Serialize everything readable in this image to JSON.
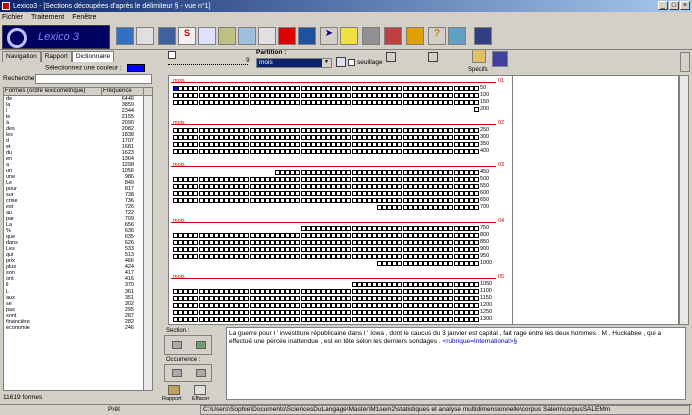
{
  "window": {
    "title": "Lexico3 - [Sections  découpées d'après le délimiteur  §  - vue n°1]"
  },
  "menu": [
    "Fichier",
    "Traitement",
    "Fenêtre"
  ],
  "app_logo": "Lexico 3",
  "left_panel": {
    "tabs": [
      "Navigation",
      "Rapport",
      "Dictionnaire"
    ],
    "active_tab": "Dictionnaire",
    "select_color_label": "Sélectionnez une couleur :",
    "select_color_value": "#0000ff",
    "search_label": "Recherche :",
    "search_value": "",
    "table": {
      "headers": [
        "Formes (ordre lexicométrique)",
        "Fréquence"
      ],
      "rows": [
        [
          "de",
          "6446"
        ],
        [
          "la",
          "3859"
        ],
        [
          "l",
          "2344"
        ],
        [
          "le",
          "2155"
        ],
        [
          "à",
          "2090"
        ],
        [
          "des",
          "2082"
        ],
        [
          "les",
          "1838"
        ],
        [
          "d",
          "1707"
        ],
        [
          "et",
          "1681"
        ],
        [
          "du",
          "1623"
        ],
        [
          "en",
          "1364"
        ],
        [
          "a",
          "1298"
        ],
        [
          "un",
          "1056"
        ],
        [
          "une",
          "986"
        ],
        [
          "Le",
          "849"
        ],
        [
          "pour",
          "817"
        ],
        [
          "sur",
          "738"
        ],
        [
          "crise",
          "736"
        ],
        [
          "est",
          "726"
        ],
        [
          "au",
          "722"
        ],
        [
          "par",
          "709"
        ],
        [
          "La",
          "656"
        ],
        [
          "%",
          "636"
        ],
        [
          "que",
          "635"
        ],
        [
          "dans",
          "626"
        ],
        [
          "Les",
          "533"
        ],
        [
          "qui",
          "513"
        ],
        [
          "prix",
          "466"
        ],
        [
          "plus",
          "424"
        ],
        [
          "son",
          "417"
        ],
        [
          "ont",
          "416"
        ],
        [
          "il",
          "370"
        ],
        [
          "L",
          "361"
        ],
        [
          "aux",
          "351"
        ],
        [
          "se",
          "302"
        ],
        [
          "pas",
          "295"
        ],
        [
          "sont",
          "287"
        ],
        [
          "financière",
          "282"
        ],
        [
          "économie",
          "246"
        ]
      ]
    },
    "count": "11619 formes"
  },
  "partition": {
    "label": "Partition :",
    "value": "mois",
    "slider_max": "9",
    "seuillage_label": "seuillage",
    "specifs_label": "Spécifs"
  },
  "sections": [
    {
      "label": "mois",
      "num": "01",
      "rows": [
        [
          "50",
          60
        ],
        [
          "100",
          60
        ],
        [
          "150",
          60
        ],
        [
          "200",
          1
        ]
      ]
    },
    {
      "label": "mois",
      "num": "02",
      "rows": [
        [
          "250",
          60
        ],
        [
          "300",
          60
        ],
        [
          "350",
          60
        ],
        [
          "400",
          60
        ]
      ]
    },
    {
      "label": "mois",
      "num": "03",
      "rows": [
        [
          "450",
          40
        ],
        [
          "500",
          60
        ],
        [
          "550",
          60
        ],
        [
          "600",
          60
        ],
        [
          "650",
          60
        ],
        [
          "700",
          20
        ]
      ]
    },
    {
      "label": "mois",
      "num": "04",
      "rows": [
        [
          "750",
          35
        ],
        [
          "800",
          60
        ],
        [
          "850",
          60
        ],
        [
          "900",
          60
        ],
        [
          "950",
          60
        ],
        [
          "1000",
          20
        ]
      ]
    },
    {
      "label": "mois",
      "num": "05",
      "rows": [
        [
          "1050",
          25
        ],
        [
          "1100",
          60
        ],
        [
          "1150",
          60
        ],
        [
          "1200",
          60
        ],
        [
          "1250",
          60
        ],
        [
          "1300",
          60
        ]
      ]
    }
  ],
  "controls": {
    "section_label": "Section :",
    "occurrence_label": "Occurrence :",
    "rapport_label": "Rapport",
    "effacer_label": "Effacer"
  },
  "context": {
    "text": "La guerre pour l ' investiture républicaine dans l ' Iowa , dont le caucus du 3 janvier est capital , fait rage entre les deux hommes . M . Huckabee , qui a effectué une percée inattendue , est en tête selon les derniers sondages . ",
    "tag": "<rubrique=International>§"
  },
  "status": {
    "state": "Prêt",
    "path": "C:\\Users\\Sophie\\Documents\\SciencesDuLangage\\Master\\M1sem2\\statistiques et analyse multidimensionnelle\\corpus Salem\\corpusSALEMm"
  }
}
